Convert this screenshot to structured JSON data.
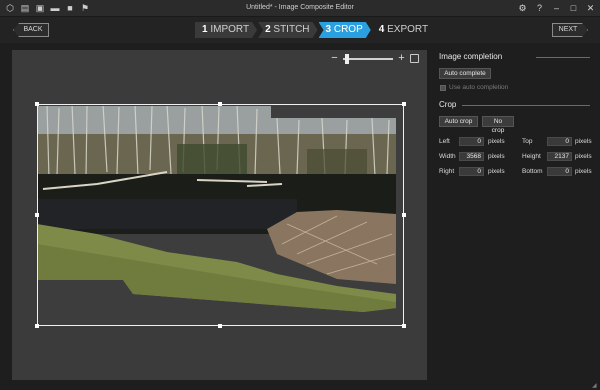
{
  "window": {
    "title": "Untitled* - Image Composite Editor",
    "toolbar_icons": [
      "new-project-icon",
      "new-panorama-icon",
      "new-video-panorama-icon",
      "open-icon",
      "save-icon",
      "publish-icon"
    ],
    "controls": [
      "settings-icon",
      "help-icon",
      "minimize-icon",
      "maximize-icon",
      "close-icon"
    ]
  },
  "nav": {
    "back_label": "BACK",
    "next_label": "NEXT",
    "steps": [
      {
        "num": "1",
        "label": "IMPORT"
      },
      {
        "num": "2",
        "label": "STITCH"
      },
      {
        "num": "3",
        "label": "CROP"
      },
      {
        "num": "4",
        "label": "EXPORT"
      }
    ],
    "active_step": "3"
  },
  "zoom": {
    "minus": "−",
    "plus": "+",
    "level": 0.05
  },
  "image_completion": {
    "title": "Image completion",
    "auto_complete_label": "Auto complete",
    "use_auto_label": "Use auto completion"
  },
  "crop": {
    "title": "Crop",
    "auto_crop_label": "Auto crop",
    "no_crop_label": "No crop",
    "unit": "pixels",
    "fields": {
      "left": {
        "label": "Left",
        "value": "0"
      },
      "top": {
        "label": "Top",
        "value": "0"
      },
      "width": {
        "label": "Width",
        "value": "3568"
      },
      "height": {
        "label": "Height",
        "value": "2137"
      },
      "right": {
        "label": "Right",
        "value": "0"
      },
      "bottom": {
        "label": "Bottom",
        "value": "0"
      }
    }
  },
  "colors": {
    "accent": "#2aa0e0",
    "background": "#1e1e1e",
    "canvas": "#3b3b3b"
  }
}
